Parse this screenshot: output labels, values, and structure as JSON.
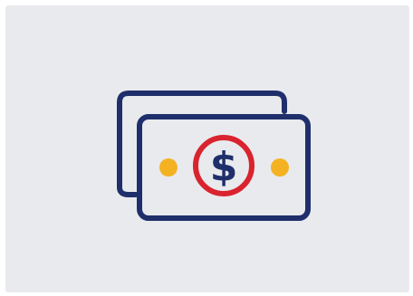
{
  "icon": {
    "name": "money-bills-icon",
    "colors": {
      "background": "#e9eaed",
      "outline": "#1f2f6b",
      "coin_ring": "#d9232e",
      "dots": "#f4b223"
    },
    "symbol": "$"
  }
}
